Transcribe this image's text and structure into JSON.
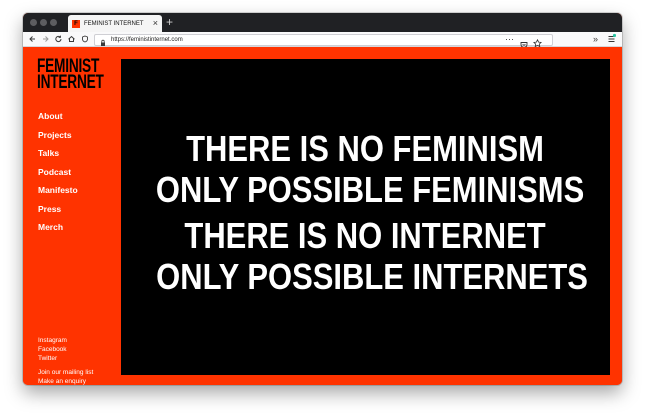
{
  "browser": {
    "tab_title": "FEMINIST INTERNET",
    "tab_favicon_letter": "F",
    "tab_close": "×",
    "new_tab": "+",
    "url": "https://feministinternet.com"
  },
  "site": {
    "logo_line1": "FEMINIST",
    "logo_line2": "INTERNET",
    "nav": [
      "About",
      "Projects",
      "Talks",
      "Podcast",
      "Manifesto",
      "Press",
      "Merch"
    ],
    "social": [
      "Instagram",
      "Facebook",
      "Twitter"
    ],
    "footer": [
      "Join our mailing list",
      "Make an enquiry"
    ]
  },
  "hero": {
    "lines": [
      "THERE IS NO FEMINISM",
      "ONLY POSSIBLE FEMINISMS",
      "THERE IS NO INTERNET",
      "ONLY POSSIBLE INTERNETS"
    ]
  },
  "colors": {
    "brand": "#ff3300",
    "hero_bg": "#000000",
    "text_light": "#ffffff"
  }
}
